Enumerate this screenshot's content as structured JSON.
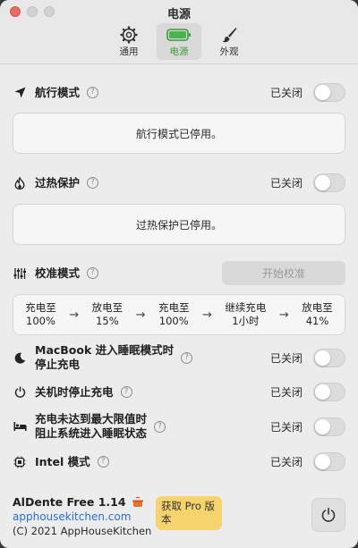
{
  "window": {
    "title": "电源"
  },
  "tabs": [
    {
      "label": "通用",
      "icon": "gear-icon",
      "active": false
    },
    {
      "label": "电源",
      "icon": "battery-icon",
      "active": true
    },
    {
      "label": "外观",
      "icon": "paintbrush-icon",
      "active": false
    }
  ],
  "airplane": {
    "label": "航行模式",
    "state": "已关闭",
    "panel_text": "航行模式已停用。"
  },
  "heat": {
    "label": "过热保护",
    "state": "已关闭",
    "panel_text": "过热保护已停用。"
  },
  "calibration": {
    "label": "校准模式",
    "button": "开始校准",
    "steps": [
      {
        "line1": "充电至",
        "line2": "100%"
      },
      {
        "line1": "放电至",
        "line2": "15%"
      },
      {
        "line1": "充电至",
        "line2": "100%"
      },
      {
        "line1": "继续充电",
        "line2": "1小时"
      },
      {
        "line1": "放电至",
        "line2": "41%"
      }
    ]
  },
  "sleep": {
    "label_line1": "MacBook 进入睡眠模式时",
    "label_line2": "停止充电",
    "state": "已关闭"
  },
  "shutdown": {
    "label": "关机时停止充电",
    "state": "已关闭"
  },
  "prevent_sleep": {
    "label_line1": "充电未达到最大限值时",
    "label_line2": "阻止系统进入睡眠状态",
    "state": "已关闭"
  },
  "intel": {
    "label": "Intel 模式",
    "state": "已关闭"
  },
  "footer": {
    "app_name": "AlDente Free 1.14",
    "link": "apphousekitchen.com",
    "copyright": "(C) 2021 AppHouseKitchen",
    "pro_button": "获取 Pro 版本"
  },
  "colors": {
    "accent_green": "#3a9b3a",
    "pro_yellow": "#f6d36c",
    "link_blue": "#2a6fdb"
  }
}
